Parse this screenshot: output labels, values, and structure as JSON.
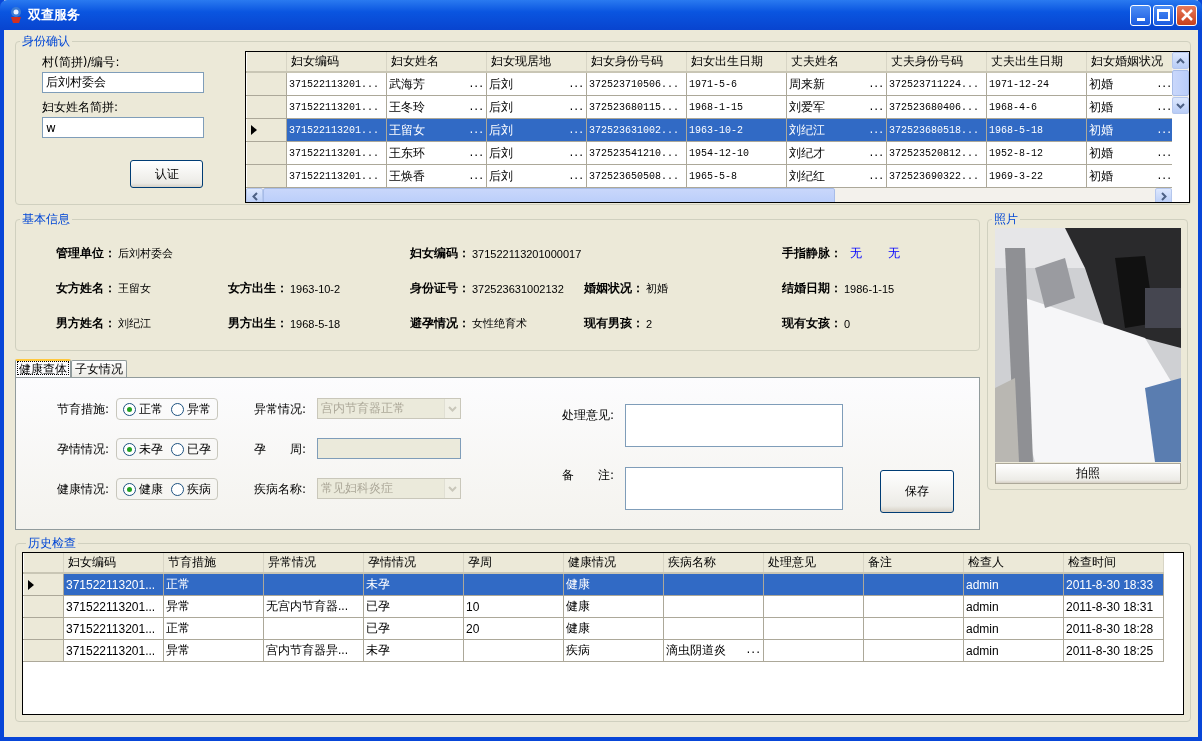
{
  "window": {
    "title": "双查服务"
  },
  "identity": {
    "title": "身份确认",
    "fields": [
      {
        "label": "村(简拼)/编号:",
        "value": "后刘村委会"
      },
      {
        "label": "妇女姓名简拼:",
        "value": "w"
      }
    ],
    "button": "认证",
    "grid": {
      "columns": [
        "妇女编码",
        "妇女姓名",
        "妇女现居地",
        "妇女身份号码",
        "妇女出生日期",
        "丈夫姓名",
        "丈夫身份号码",
        "丈夫出生日期",
        "妇女婚姻状况"
      ],
      "rows": [
        {
          "selected": false,
          "cells": [
            "371522113201...",
            {
              "text": "武海芳",
              "button": "..."
            },
            {
              "text": "后刘",
              "button": "..."
            },
            "372523710506...",
            "1971-5-6",
            {
              "text": "周来新",
              "button": "..."
            },
            "372523711224...",
            "1971-12-24",
            {
              "text": "初婚",
              "button": "..."
            }
          ]
        },
        {
          "selected": false,
          "cells": [
            "371522113201...",
            {
              "text": "王冬玲",
              "button": "..."
            },
            {
              "text": "后刘",
              "button": "..."
            },
            "372523680115...",
            "1968-1-15",
            {
              "text": "刘爱军",
              "button": "..."
            },
            "372523680406...",
            "1968-4-6",
            {
              "text": "初婚",
              "button": "..."
            }
          ]
        },
        {
          "selected": true,
          "cells": [
            "371522113201...",
            {
              "text": "王留女",
              "button": "..."
            },
            {
              "text": "后刘",
              "button": "..."
            },
            "372523631002...",
            "1963-10-2",
            {
              "text": "刘纪江",
              "button": "..."
            },
            "372523680518...",
            "1968-5-18",
            {
              "text": "初婚",
              "button": "..."
            }
          ]
        },
        {
          "selected": false,
          "cells": [
            "371522113201...",
            {
              "text": "王东环",
              "button": "..."
            },
            {
              "text": "后刘",
              "button": "..."
            },
            "372523541210...",
            "1954-12-10",
            {
              "text": "刘纪才",
              "button": "..."
            },
            "372523520812...",
            "1952-8-12",
            {
              "text": "初婚",
              "button": "..."
            }
          ]
        },
        {
          "selected": false,
          "cells": [
            "371522113201...",
            {
              "text": "王焕香",
              "button": "..."
            },
            {
              "text": "后刘",
              "button": "..."
            },
            "372523650508...",
            "1965-5-8",
            {
              "text": "刘纪红",
              "button": "..."
            },
            "372523690322...",
            "1969-3-22",
            {
              "text": "初婚",
              "button": "..."
            }
          ]
        }
      ]
    }
  },
  "basic_info": {
    "title": "基本信息",
    "rows": [
      [
        {
          "label": "管理单位：",
          "value": "后刘村委会"
        },
        null,
        {
          "label": "妇女编码：",
          "value": "371522113201000017"
        },
        null,
        {
          "label": "手指静脉：",
          "links": [
            "无",
            "无"
          ]
        }
      ],
      [
        {
          "label": "女方姓名：",
          "value": "王留女"
        },
        {
          "label": "女方出生：",
          "value": "1963-10-2"
        },
        {
          "label": "身份证号：",
          "value": "372523631002132"
        },
        {
          "label": "婚姻状况：",
          "value": "初婚"
        },
        {
          "label": "结婚日期：",
          "value": "1986-1-15"
        }
      ],
      [
        {
          "label": "男方姓名：",
          "value": "刘纪江"
        },
        {
          "label": "男方出生：",
          "value": "1968-5-18"
        },
        {
          "label": "避孕情况：",
          "value": "女性绝育术"
        },
        {
          "label": "现有男孩：",
          "value": "2"
        },
        {
          "label": "现有女孩：",
          "value": "0"
        }
      ]
    ]
  },
  "photo": {
    "title": "照片",
    "button": "拍照"
  },
  "tabs": [
    {
      "label": "健康查体",
      "selected": true
    },
    {
      "label": "子女情况",
      "selected": false
    }
  ],
  "exam_form": {
    "radios": [
      {
        "label": "节育措施:",
        "options": [
          {
            "label": "正常",
            "selected": true
          },
          {
            "label": "异常",
            "selected": false
          }
        ]
      },
      {
        "label": "孕情情况:",
        "options": [
          {
            "label": "未孕",
            "selected": true
          },
          {
            "label": "已孕",
            "selected": false
          }
        ]
      },
      {
        "label": "健康情况:",
        "options": [
          {
            "label": "健康",
            "selected": true
          },
          {
            "label": "疾病",
            "selected": false
          }
        ]
      }
    ],
    "fields": [
      {
        "kind": "combo",
        "label": "异常情况:",
        "value": "宫内节育器正常",
        "disabled": true
      },
      {
        "kind": "text",
        "label": "孕　　周:",
        "disabled": true
      },
      {
        "kind": "combo",
        "label": "疾病名称:",
        "value": "常见妇科炎症",
        "disabled": true
      }
    ],
    "notes": [
      {
        "label": "处理意见:"
      },
      {
        "label": "备　　注:"
      }
    ],
    "button": "保存"
  },
  "history": {
    "title": "历史检查",
    "columns": [
      "妇女编码",
      "节育措施",
      "异常情况",
      "孕情情况",
      "孕周",
      "健康情况",
      "疾病名称",
      "处理意见",
      "备注",
      "检查人",
      "检查时间"
    ],
    "rows": [
      {
        "selected": true,
        "cells": [
          "371522113201...",
          "正常",
          null,
          "未孕",
          null,
          "健康",
          null,
          null,
          null,
          "admin",
          "2011-8-30 18:33"
        ]
      },
      {
        "selected": false,
        "cells": [
          "371522113201...",
          "异常",
          "无宫内节育器...",
          "已孕",
          "10",
          "健康",
          null,
          null,
          null,
          "admin",
          "2011-8-30 18:31"
        ]
      },
      {
        "selected": false,
        "cells": [
          "371522113201...",
          "正常",
          null,
          "已孕",
          "20",
          "健康",
          null,
          null,
          null,
          "admin",
          "2011-8-30 18:28"
        ]
      },
      {
        "selected": false,
        "cells": [
          "371522113201...",
          "异常",
          "宫内节育器异...",
          "未孕",
          null,
          "疾病",
          {
            "text": "滴虫阴道炎",
            "button": "..."
          },
          null,
          null,
          "admin",
          "2011-8-30 18:25"
        ]
      }
    ]
  }
}
